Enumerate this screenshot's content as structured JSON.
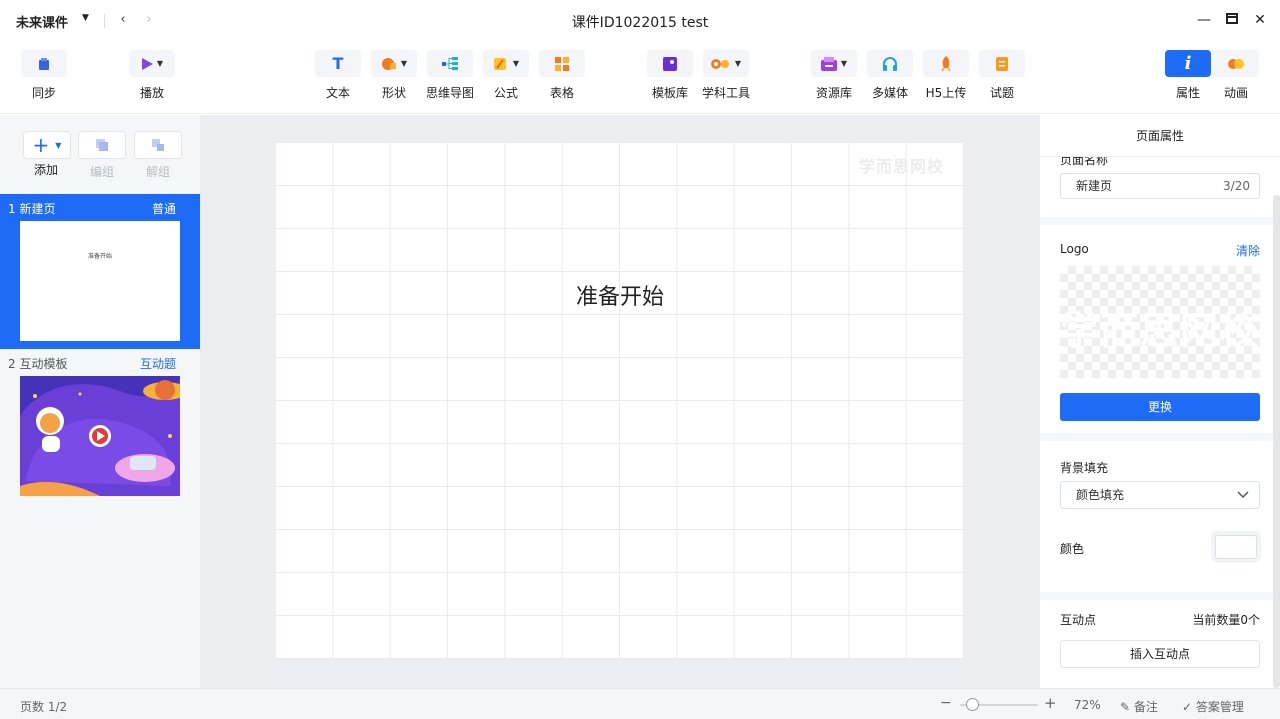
{
  "titlebar": {
    "app_name": "未来课件",
    "document_title": "课件ID1022015 test"
  },
  "toolbar": {
    "sync": "同步",
    "play": "播放",
    "text": "文本",
    "shape": "形状",
    "mindmap": "思维导图",
    "formula": "公式",
    "table": "表格",
    "template": "模板库",
    "subject_tools": "学科工具",
    "resources": "资源库",
    "multimedia": "多媒体",
    "h5_upload": "H5上传",
    "quiz": "试题",
    "properties": "属性",
    "animation": "动画"
  },
  "sidebar": {
    "add": "添加",
    "group": "编组",
    "ungroup": "解组",
    "slides": [
      {
        "title": "1 新建页",
        "type": "普通",
        "preview_text": "准备开始"
      },
      {
        "title": "2 互动模板",
        "type": "互动题"
      }
    ]
  },
  "canvas": {
    "watermark": "学而思网校",
    "text": "准备开始"
  },
  "properties": {
    "panel_title": "页面属性",
    "page_name_label": "页面名称",
    "page_name_value": "新建页",
    "page_name_count": "3/20",
    "logo_label": "Logo",
    "logo_clear": "清除",
    "logo_image_text": "学而思网校",
    "replace_button": "更换",
    "bg_fill_label": "背景填充",
    "bg_fill_value": "颜色填充",
    "color_label": "颜色",
    "color_value": "#ffffff",
    "hotspot_label": "互动点",
    "hotspot_count": "当前数量0个",
    "insert_hotspot": "插入互动点"
  },
  "statusbar": {
    "page_count": "页数 1/2",
    "zoom": "72%",
    "notes": "备注",
    "answer_mgmt": "答案管理"
  },
  "colors": {
    "accent": "#1e6cf5"
  }
}
